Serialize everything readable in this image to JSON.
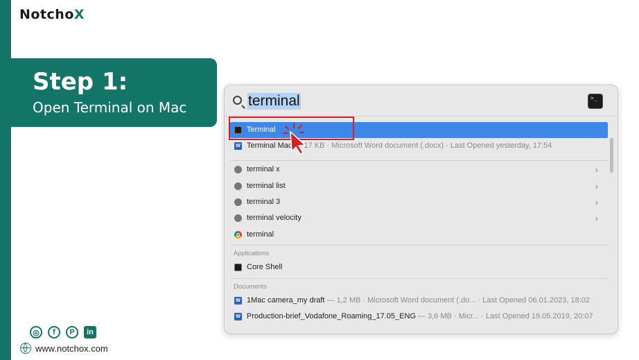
{
  "brand": {
    "logo_main": "Notcho",
    "logo_x": "X",
    "website": "www.notchox.com"
  },
  "step": {
    "title": "Step 1:",
    "subtitle": "Open Terminal on Mac"
  },
  "socials": [
    {
      "name": "instagram-icon",
      "glyph": "◎"
    },
    {
      "name": "facebook-icon",
      "glyph": "f"
    },
    {
      "name": "pinterest-icon",
      "glyph": "P"
    },
    {
      "name": "linkedin-icon",
      "glyph": "in"
    }
  ],
  "spotlight": {
    "query": "terminal",
    "top_hits": [
      {
        "label": "Terminal",
        "meta": "",
        "icon": "terminal-icon",
        "selected": true
      },
      {
        "label": "Terminal Mac",
        "meta": " — 17 KB · Microsoft Word document (.docx) · Last Opened yesterday, 17:54",
        "icon": "word-document-icon",
        "selected": false
      }
    ],
    "suggestions": [
      {
        "label": "terminal x",
        "icon": "search-icon",
        "chevron": true
      },
      {
        "label": "terminal list",
        "icon": "search-icon",
        "chevron": true
      },
      {
        "label": "terminal 3",
        "icon": "search-icon",
        "chevron": true
      },
      {
        "label": "terminal velocity",
        "icon": "search-icon",
        "chevron": true
      },
      {
        "label": "terminal",
        "icon": "chrome-icon",
        "chevron": false
      }
    ],
    "applications_header": "Applications",
    "applications": [
      {
        "label": "Core Shell",
        "icon": "shell-icon"
      }
    ],
    "documents_header": "Documents",
    "documents": [
      {
        "label": "1Mac camera_my draft",
        "meta": " — 1,2 MB · Microsoft Word document (.do... · Last Opened 06.01.2023, 18:02"
      },
      {
        "label": "Production-brief_Vodafone_Roaming_17.05_ENG",
        "meta": " — 3,6 MB · Micr... · Last Opened 19.05.2019, 20:07"
      }
    ]
  },
  "colors": {
    "brand": "#137568",
    "selection": "#3f87e6",
    "highlight_box": "#d32027"
  }
}
